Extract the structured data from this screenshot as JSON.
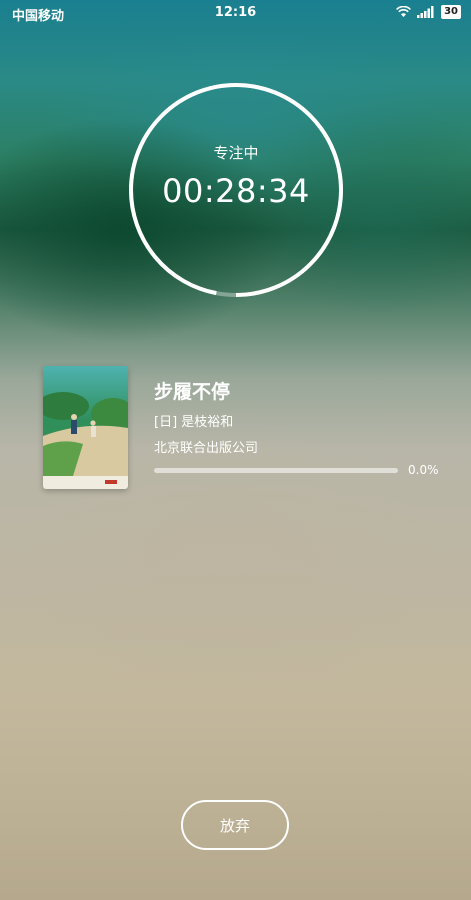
{
  "status_bar": {
    "carrier": "中国移动",
    "time": "12:16",
    "battery": "30",
    "icons": [
      "wifi-icon",
      "signal-icon",
      "battery-icon"
    ]
  },
  "timer": {
    "label": "专注中",
    "value": "00:28:34",
    "ring_progress_fraction": 0.97,
    "ring_color": "#ffffff"
  },
  "book": {
    "title": "步履不停",
    "author": "[日] 是枝裕和",
    "publisher": "北京联合出版公司",
    "progress": 0.0,
    "progress_text": "0.0%"
  },
  "actions": {
    "give_up_label": "放弃"
  },
  "colors": {
    "text": "#ffffff",
    "progress_track": "#e6e6e6"
  }
}
